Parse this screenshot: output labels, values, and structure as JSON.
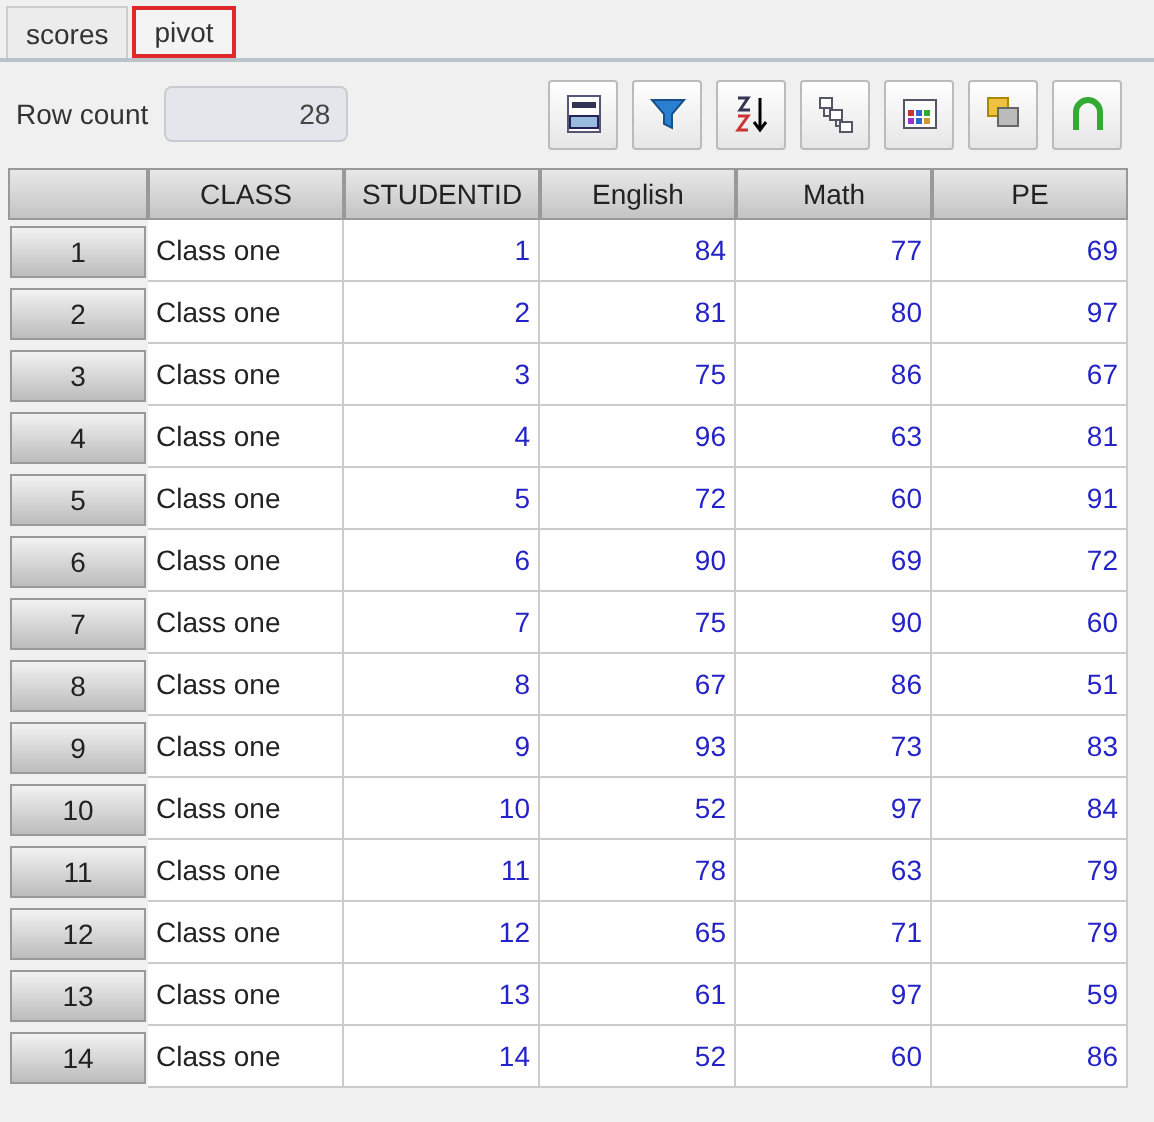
{
  "tabs": [
    {
      "label": "scores",
      "selected": false
    },
    {
      "label": "pivot",
      "selected": true
    }
  ],
  "row_count": {
    "label": "Row count",
    "value": "28"
  },
  "table": {
    "columns": [
      "CLASS",
      "STUDENTID",
      "English",
      "Math",
      "PE"
    ],
    "rows": [
      {
        "number": "1",
        "cells": [
          "Class one",
          "1",
          "84",
          "77",
          "69"
        ]
      },
      {
        "number": "2",
        "cells": [
          "Class one",
          "2",
          "81",
          "80",
          "97"
        ]
      },
      {
        "number": "3",
        "cells": [
          "Class one",
          "3",
          "75",
          "86",
          "67"
        ]
      },
      {
        "number": "4",
        "cells": [
          "Class one",
          "4",
          "96",
          "63",
          "81"
        ]
      },
      {
        "number": "5",
        "cells": [
          "Class one",
          "5",
          "72",
          "60",
          "91"
        ]
      },
      {
        "number": "6",
        "cells": [
          "Class one",
          "6",
          "90",
          "69",
          "72"
        ]
      },
      {
        "number": "7",
        "cells": [
          "Class one",
          "7",
          "75",
          "90",
          "60"
        ]
      },
      {
        "number": "8",
        "cells": [
          "Class one",
          "8",
          "67",
          "86",
          "51"
        ]
      },
      {
        "number": "9",
        "cells": [
          "Class one",
          "9",
          "93",
          "73",
          "83"
        ]
      },
      {
        "number": "10",
        "cells": [
          "Class one",
          "10",
          "52",
          "97",
          "84"
        ]
      },
      {
        "number": "11",
        "cells": [
          "Class one",
          "11",
          "78",
          "63",
          "79"
        ]
      },
      {
        "number": "12",
        "cells": [
          "Class one",
          "12",
          "65",
          "71",
          "79"
        ]
      },
      {
        "number": "13",
        "cells": [
          "Class one",
          "13",
          "61",
          "97",
          "59"
        ]
      },
      {
        "number": "14",
        "cells": [
          "Class one",
          "14",
          "52",
          "60",
          "86"
        ]
      }
    ]
  }
}
